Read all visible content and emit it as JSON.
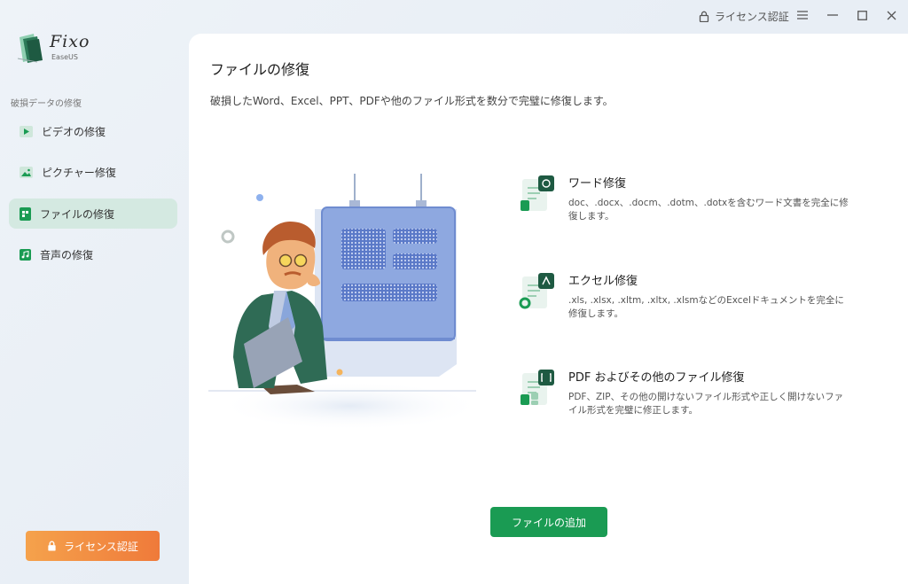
{
  "titlebar": {
    "license_label": "ライセンス認証",
    "icons": [
      "lock-icon",
      "menu-icon",
      "minimize-icon",
      "maximize-icon",
      "close-icon"
    ]
  },
  "app": {
    "name": "Fixo",
    "vendor": "EaseUS"
  },
  "sidebar": {
    "section_label": "破損データの修復",
    "items": [
      {
        "label": "ビデオの修復",
        "icon": "video-icon",
        "active": false
      },
      {
        "label": "ピクチャー修復",
        "icon": "picture-icon",
        "active": false
      },
      {
        "label": "ファイルの修復",
        "icon": "file-icon",
        "active": true
      },
      {
        "label": "音声の修復",
        "icon": "music-icon",
        "active": false
      }
    ],
    "license_button": "ライセンス認証"
  },
  "main": {
    "title": "ファイルの修復",
    "description": "破損したWord、Excel、PPT、PDFや他のファイル形式を数分で完璧に修復します。",
    "features": [
      {
        "title": "ワード修復",
        "desc": "doc、.docx、.docm、.dotm、.dotxを含むワード文書を完全に修復します。",
        "icon": "word-icon"
      },
      {
        "title": "エクセル修復",
        "desc": ".xls, .xlsx, .xltm, .xltx, .xlsmなどのExcelドキュメントを完全に修復します。",
        "icon": "excel-icon"
      },
      {
        "title": "PDF およびその他のファイル修復",
        "desc": "PDF、ZIP、その他の開けないファイル形式や正しく開けないファイル形式を完璧に修正します。",
        "icon": "pdf-icon"
      }
    ],
    "add_button": "ファイルの追加"
  },
  "colors": {
    "accent": "#1a9b53",
    "license": "#f08a3e",
    "active_nav": "#d4e9e1"
  }
}
